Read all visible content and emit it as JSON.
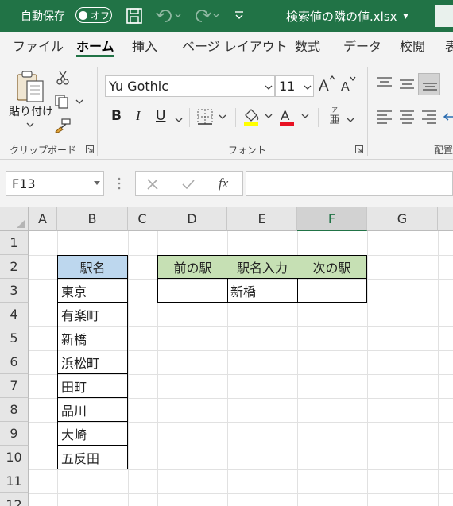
{
  "titlebar": {
    "autosave_label": "自動保存",
    "autosave_state": "オフ",
    "filename": "検索値の隣の値.xlsx",
    "dropdown_arrow": "▾"
  },
  "tabs": [
    "ファイル",
    "ホーム",
    "挿入",
    "ページ レイアウト",
    "数式",
    "データ",
    "校閲",
    "表"
  ],
  "active_tab": "ホーム",
  "ribbon": {
    "paste_label": "貼り付け",
    "clipboard_group": "クリップボード",
    "font_name": "Yu Gothic",
    "font_size": "11",
    "font_group": "フォント",
    "bold": "B",
    "italic": "I",
    "underline": "U",
    "font_color_letter": "A",
    "font_color": "#e81123",
    "highlight_color": "#ffff00",
    "phonetic_top": "ア",
    "phonetic_bottom": "亜",
    "alignment_group": "配置"
  },
  "formula_bar": {
    "name_box": "F13",
    "fx_label": "fx",
    "formula": ""
  },
  "sheet": {
    "columns": [
      "A",
      "B",
      "C",
      "D",
      "E",
      "F",
      "G"
    ],
    "selected_column": "F",
    "rows": [
      "1",
      "2",
      "3",
      "4",
      "5",
      "6",
      "7",
      "8",
      "9",
      "10",
      "11",
      "12"
    ],
    "station_header": "駅名",
    "stations": [
      "東京",
      "有楽町",
      "新橋",
      "浜松町",
      "田町",
      "品川",
      "大崎",
      "五反田"
    ],
    "lookup_headers": [
      "前の駅",
      "駅名入力",
      "次の駅"
    ],
    "lookup_values": [
      "",
      "新橋",
      ""
    ]
  },
  "colors": {
    "excel_green": "#217346",
    "header_blue": "#bdd7ee",
    "header_green": "#c6e0b4"
  }
}
